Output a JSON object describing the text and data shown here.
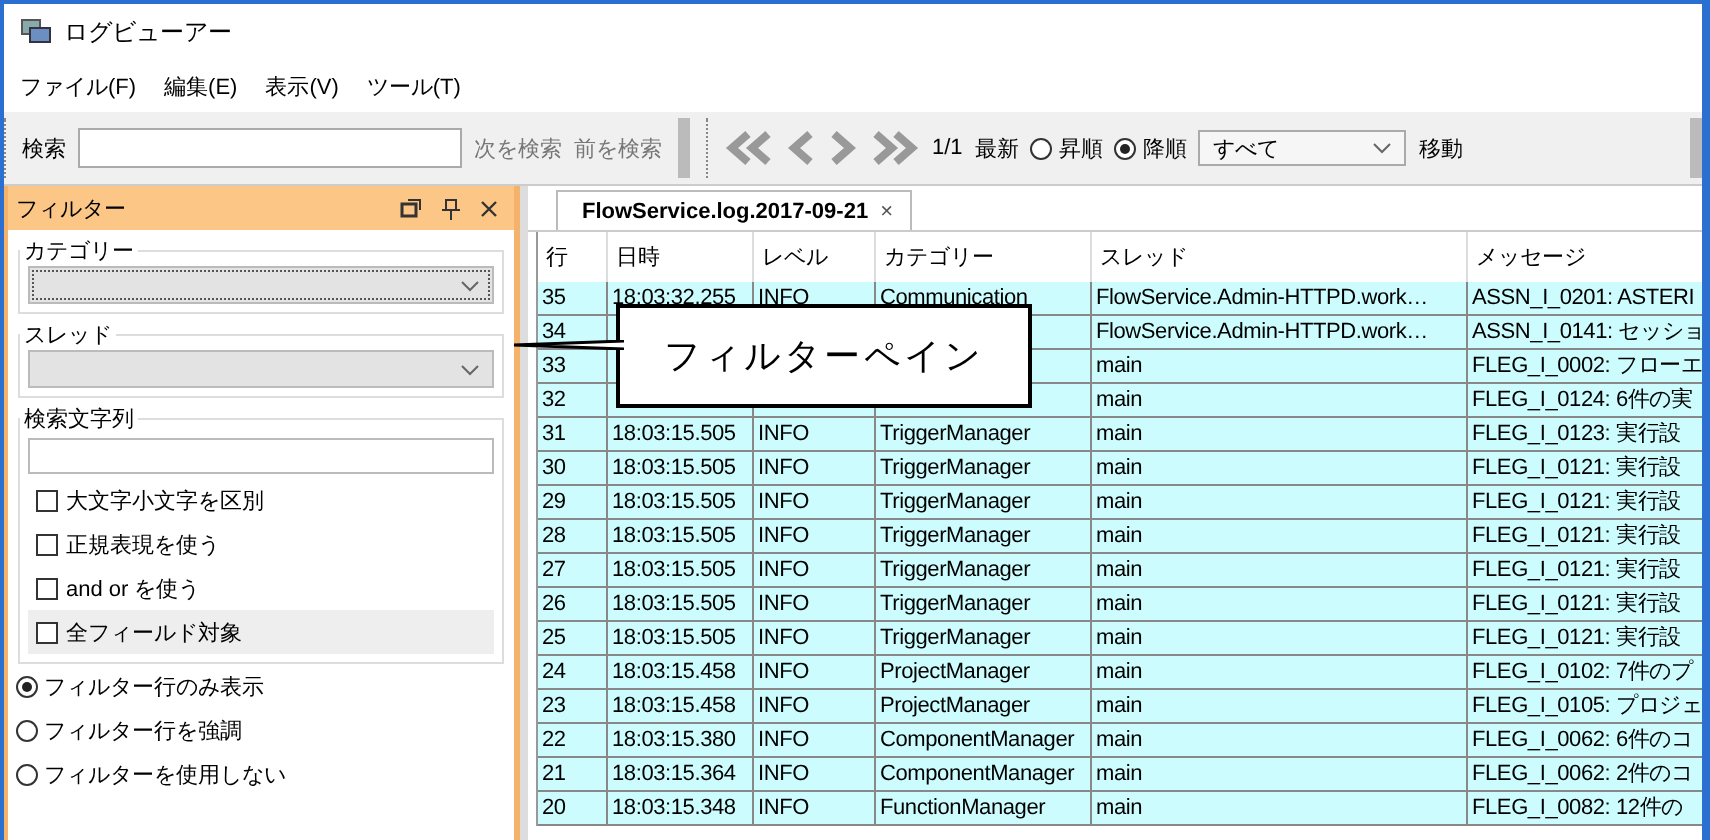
{
  "window": {
    "title": "ログビューアー"
  },
  "menu": [
    "ファイル(F)",
    "編集(E)",
    "表示(V)",
    "ツール(T)"
  ],
  "toolbar": {
    "search_label": "検索",
    "next": "次を検索",
    "prev": "前を検索",
    "page": "1/1",
    "latest": "最新",
    "sort": [
      {
        "label": "昇順",
        "selected": false
      },
      {
        "label": "降順",
        "selected": true
      }
    ],
    "level_select": "すべて",
    "go": "移動"
  },
  "filter_pane": {
    "title": "フィルター",
    "category_label": "カテゴリー",
    "thread_label": "スレッド",
    "search_label": "検索文字列",
    "options": [
      {
        "label": "大文字小文字を区別",
        "checked": false,
        "highlighted": false
      },
      {
        "label": "正規表現を使う",
        "checked": false,
        "highlighted": false
      },
      {
        "label": "and or を使う",
        "checked": false,
        "highlighted": false
      },
      {
        "label": "全フィールド対象",
        "checked": false,
        "highlighted": true
      }
    ],
    "modes": [
      {
        "label": "フィルター行のみ表示",
        "selected": true
      },
      {
        "label": "フィルター行を強調",
        "selected": false
      },
      {
        "label": "フィルターを使用しない",
        "selected": false
      }
    ]
  },
  "tab": {
    "label": "FlowService.log.2017-09-21",
    "close": "×"
  },
  "table": {
    "columns": [
      "行",
      "日時",
      "レベル",
      "カテゴリー",
      "スレッド",
      "メッセージ"
    ],
    "rows": [
      [
        "35",
        "18:03:32.255",
        "INFO",
        "Communication",
        "FlowService.Admin-HTTPD.work…",
        "ASSN_I_0201: ASTERI"
      ],
      [
        "34",
        null,
        null,
        null,
        "FlowService.Admin-HTTPD.work…",
        "ASSN_I_0141: セッショ"
      ],
      [
        "33",
        null,
        null,
        null,
        "main",
        "FLEG_I_0002: フローエ"
      ],
      [
        "32",
        null,
        null,
        null,
        "main",
        "FLEG_I_0124: 6件の実"
      ],
      [
        "31",
        "18:03:15.505",
        "INFO",
        "TriggerManager",
        "main",
        "FLEG_I_0123: 実行設"
      ],
      [
        "30",
        "18:03:15.505",
        "INFO",
        "TriggerManager",
        "main",
        "FLEG_I_0121: 実行設"
      ],
      [
        "29",
        "18:03:15.505",
        "INFO",
        "TriggerManager",
        "main",
        "FLEG_I_0121: 実行設"
      ],
      [
        "28",
        "18:03:15.505",
        "INFO",
        "TriggerManager",
        "main",
        "FLEG_I_0121: 実行設"
      ],
      [
        "27",
        "18:03:15.505",
        "INFO",
        "TriggerManager",
        "main",
        "FLEG_I_0121: 実行設"
      ],
      [
        "26",
        "18:03:15.505",
        "INFO",
        "TriggerManager",
        "main",
        "FLEG_I_0121: 実行設"
      ],
      [
        "25",
        "18:03:15.505",
        "INFO",
        "TriggerManager",
        "main",
        "FLEG_I_0121: 実行設"
      ],
      [
        "24",
        "18:03:15.458",
        "INFO",
        "ProjectManager",
        "main",
        "FLEG_I_0102: 7件のプ"
      ],
      [
        "23",
        "18:03:15.458",
        "INFO",
        "ProjectManager",
        "main",
        "FLEG_I_0105: プロジェ"
      ],
      [
        "22",
        "18:03:15.380",
        "INFO",
        "ComponentManager",
        "main",
        "FLEG_I_0062: 6件のコ"
      ],
      [
        "21",
        "18:03:15.364",
        "INFO",
        "ComponentManager",
        "main",
        "FLEG_I_0062: 2件のコ"
      ],
      [
        "20",
        "18:03:15.348",
        "INFO",
        "FunctionManager",
        "main",
        "FLEG_I_0082: 12件の"
      ]
    ]
  },
  "callout": "フィルターペイン"
}
